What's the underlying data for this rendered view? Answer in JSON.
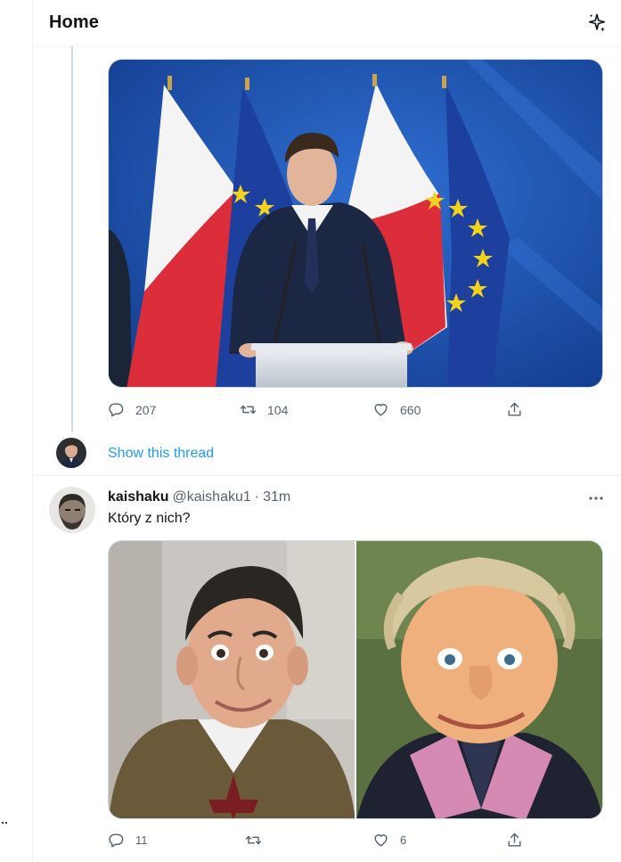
{
  "header": {
    "title": "Home",
    "sparkle_icon": "sparkle-icon"
  },
  "tweet1": {
    "stats": {
      "replies": "207",
      "retweets": "104",
      "likes": "660"
    }
  },
  "show_thread": {
    "label": "Show this thread"
  },
  "tweet2": {
    "name": "kaishaku",
    "handle": "@kaishaku1",
    "separator": "·",
    "time": "31m",
    "text": "Który z nich?",
    "stats": {
      "replies": "11",
      "retweets": "",
      "likes": "6"
    }
  },
  "left_edge": {
    "dots": "··"
  },
  "colors": {
    "accent": "#1d9bf0",
    "text": "#0f1419",
    "muted": "#536471",
    "border": "#cfd9de"
  }
}
